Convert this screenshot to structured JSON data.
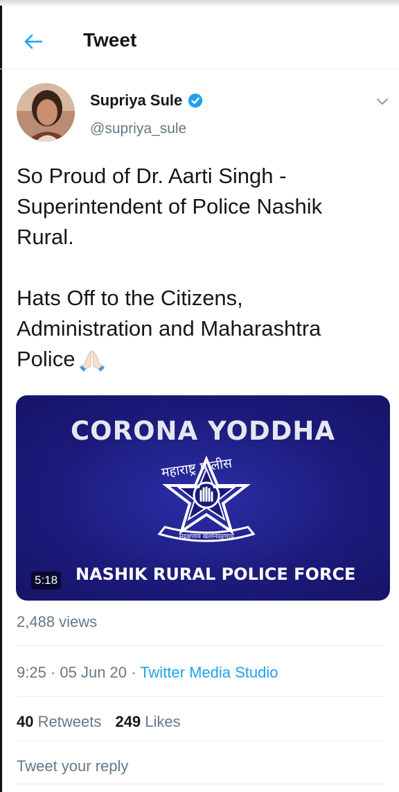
{
  "header": {
    "title": "Tweet"
  },
  "author": {
    "name": "Supriya Sule",
    "handle": "@supriya_sule",
    "verified": true
  },
  "tweet": {
    "lines_para1": [
      "So Proud of Dr. Aarti Singh -",
      "Superintendent of Police Nashik",
      "Rural."
    ],
    "lines_para2": [
      "Hats Off to the Citizens,",
      "Administration and Maharashtra",
      "Police"
    ],
    "emoji": "folded-hands"
  },
  "media": {
    "title": "CORONA YODDHA",
    "emblem_top_text": "महाराष्ट्र पोलीस",
    "emblem_ribbon_text": "सद्रक्षणाय खलनिग्रहणाय",
    "subtitle": "NASHIK RURAL POLICE FORCE",
    "duration": "5:18"
  },
  "views": "2,488 views",
  "meta": {
    "time": "9:25",
    "sep": " · ",
    "date": "05 Jun 20",
    "source": "Twitter Media Studio"
  },
  "stats": {
    "retweets_count": "40",
    "retweets_label": "Retweets",
    "likes_count": "249",
    "likes_label": "Likes"
  },
  "reply": {
    "placeholder": "Tweet your reply"
  },
  "colors": {
    "accent": "#1da1f2",
    "text": "#14171a",
    "secondary": "#657786",
    "video_bg": "#1b1a79"
  }
}
